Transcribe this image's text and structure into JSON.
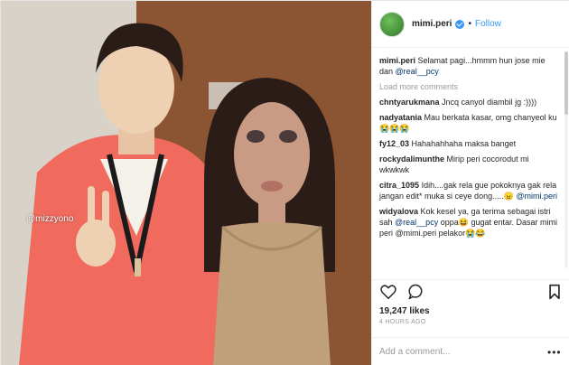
{
  "photo": {
    "watermark": "@mizzyono"
  },
  "header": {
    "username": "mimi.peri",
    "separator": "•",
    "follow_label": "Follow"
  },
  "caption": {
    "username": "mimi.peri",
    "text": "Selamat pagi...hmmm hun jose mie dan",
    "mention": "@real__pcy"
  },
  "load_more_label": "Load more comments",
  "comments": [
    {
      "username": "chntyarukmana",
      "text": "Jncq canyol diambil jg :))))",
      "mention": "",
      "after": ""
    },
    {
      "username": "nadyatania",
      "text": "Mau berkata kasar, omg chanyeol ku😭😭😭",
      "mention": "",
      "after": ""
    },
    {
      "username": "fy12_03",
      "text": "Hahahahhaha maksa banget",
      "mention": "",
      "after": ""
    },
    {
      "username": "rockydalimunthe",
      "text": "Mirip peri cocorodut mi wkwkwk",
      "mention": "",
      "after": ""
    },
    {
      "username": "citra_1095",
      "text": "Idih....gak rela gue pokoknya gak rela jangan edit* muka si ceye dong.....😠",
      "mention": "@mimi.peri",
      "after": ""
    },
    {
      "username": "widyalova",
      "text": "Kok kesel ya, ga terima sebagai istri sah",
      "mention": "@real__pcy",
      "after": "oppa😆 gugat entar. Dasar mimi peri @mimi.peri pelakor😭😂"
    }
  ],
  "likes": "19,247 likes",
  "timestamp": "4 HOURS AGO",
  "add_comment": {
    "placeholder": "Add a comment...",
    "more_label": "•••"
  },
  "icons": {
    "like": "heart-icon",
    "comment": "comment-icon",
    "save": "bookmark-icon",
    "verified": "verified-badge-icon"
  },
  "colors": {
    "link": "#3897f0",
    "mention": "#003569",
    "muted": "#999999",
    "text": "#262626"
  }
}
